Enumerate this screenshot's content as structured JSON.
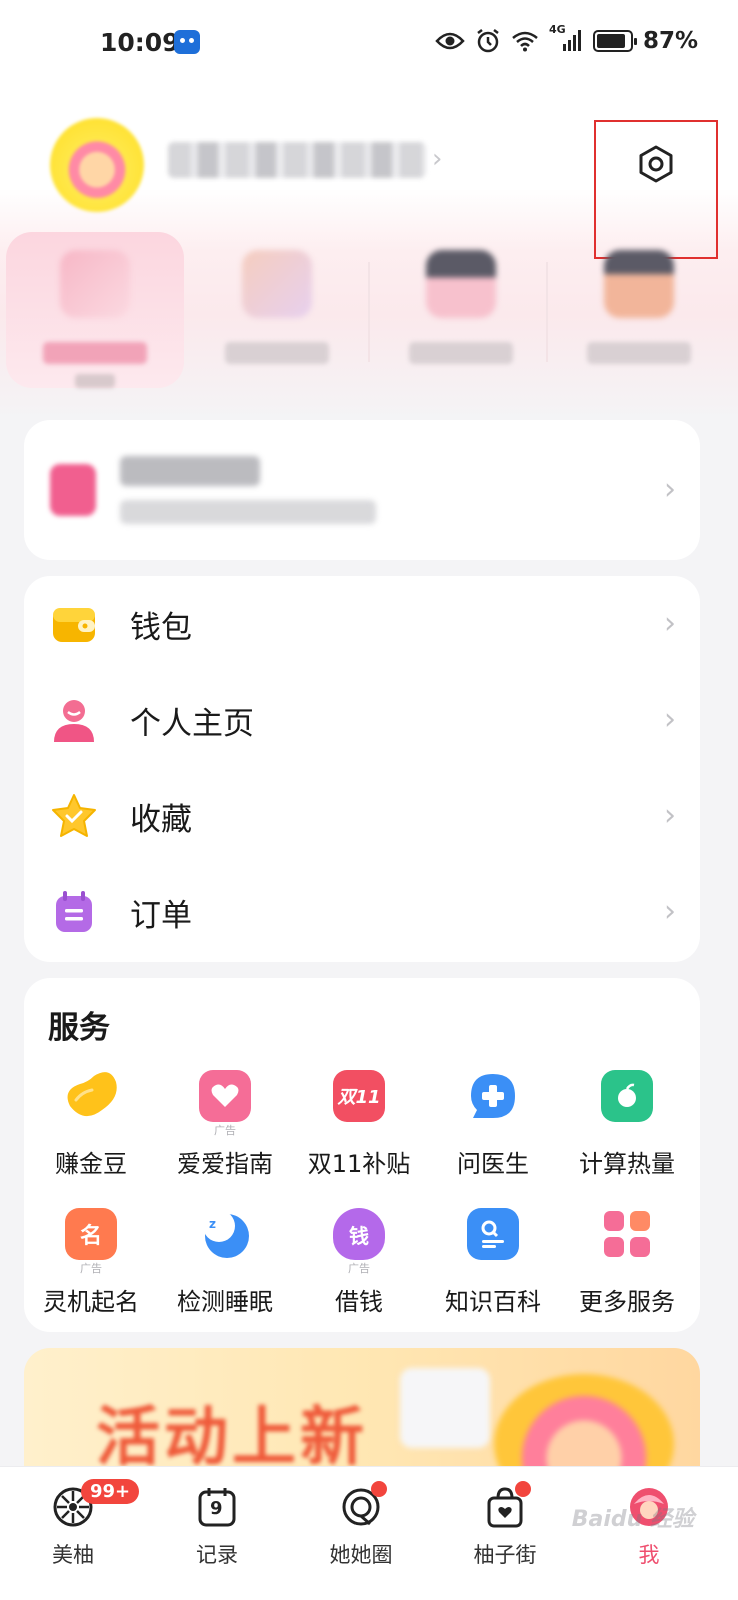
{
  "status_bar": {
    "time": "10:09",
    "network": "4G",
    "battery_percent": "87%",
    "battery_level": 0.87,
    "icons": [
      "eye-icon",
      "alarm-icon",
      "wifi-icon",
      "signal-icon",
      "battery-icon"
    ]
  },
  "profile": {
    "avatar_icon": "avatar",
    "name_redacted": true
  },
  "settings": {
    "icon": "gear-icon",
    "highlight_color": "#e0302f"
  },
  "modes": {
    "count": 4,
    "active_index": 0,
    "labels_redacted": true
  },
  "period_card": {
    "redacted": true
  },
  "menu": {
    "items": [
      {
        "label": "钱包",
        "icon": "wallet-icon"
      },
      {
        "label": "个人主页",
        "icon": "person-icon"
      },
      {
        "label": "收藏",
        "icon": "star-icon"
      },
      {
        "label": "订单",
        "icon": "order-icon"
      }
    ]
  },
  "services": {
    "title": "服务",
    "ad_tag": "广告",
    "items": [
      {
        "label": "赚金豆",
        "icon": "bean-icon",
        "ad": false
      },
      {
        "label": "爱爱指南",
        "icon": "heart-book-icon",
        "ad": true
      },
      {
        "label": "双11补贴",
        "icon": "double11-icon",
        "glyph": "双11",
        "ad": false
      },
      {
        "label": "问医生",
        "icon": "doctor-chat-icon",
        "ad": false
      },
      {
        "label": "计算热量",
        "icon": "apple-calc-icon",
        "ad": false
      },
      {
        "label": "灵机起名",
        "icon": "name-icon",
        "glyph": "名",
        "ad": true
      },
      {
        "label": "检测睡眠",
        "icon": "moon-icon",
        "ad": false
      },
      {
        "label": "借钱",
        "icon": "money-bag-icon",
        "glyph": "钱",
        "ad": true
      },
      {
        "label": "知识百科",
        "icon": "search-doc-icon",
        "ad": false
      },
      {
        "label": "更多服务",
        "icon": "grid-icon",
        "ad": false
      }
    ]
  },
  "banner": {
    "text": "活动上新"
  },
  "bottom_nav": {
    "items": [
      {
        "label": "美柚",
        "icon": "home-icon",
        "badge": "99+"
      },
      {
        "label": "记录",
        "icon": "calendar-icon",
        "glyph": "9"
      },
      {
        "label": "她她圈",
        "icon": "circle-icon",
        "dot": true
      },
      {
        "label": "柚子街",
        "icon": "shop-bag-icon",
        "dot": true
      },
      {
        "label": "我",
        "icon": "me-icon",
        "active": true
      }
    ]
  },
  "watermark": "Baidu 经验",
  "colors": {
    "accent": "#ef4f6f",
    "badge": "#f2453d",
    "background": "#f4f4f6"
  }
}
